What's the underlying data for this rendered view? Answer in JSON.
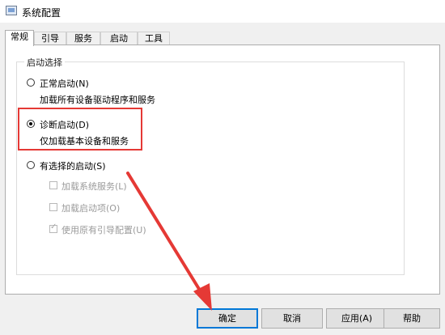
{
  "window": {
    "title": "系统配置",
    "icon": "app-window-icon"
  },
  "tabs": [
    {
      "label": "常规",
      "active": true
    },
    {
      "label": "引导",
      "active": false
    },
    {
      "label": "服务",
      "active": false
    },
    {
      "label": "启动",
      "active": false
    },
    {
      "label": "工具",
      "active": false
    }
  ],
  "startup": {
    "group_label": "启动选择",
    "options": [
      {
        "label": "正常启动(N)",
        "description": "加载所有设备驱动程序和服务",
        "checked": false
      },
      {
        "label": "诊断启动(D)",
        "description": "仅加载基本设备和服务",
        "checked": true
      },
      {
        "label": "有选择的启动(S)",
        "checked": false
      }
    ],
    "selective": [
      {
        "label": "加载系统服务(L)",
        "checked": false
      },
      {
        "label": "加载启动项(O)",
        "checked": false
      },
      {
        "label": "使用原有引导配置(U)",
        "checked": true
      }
    ]
  },
  "buttons": {
    "ok": "确定",
    "cancel": "取消",
    "apply": "应用(A)",
    "help": "帮助"
  },
  "annotation": {
    "highlight_color": "#e53935",
    "arrow_color": "#e53935"
  }
}
